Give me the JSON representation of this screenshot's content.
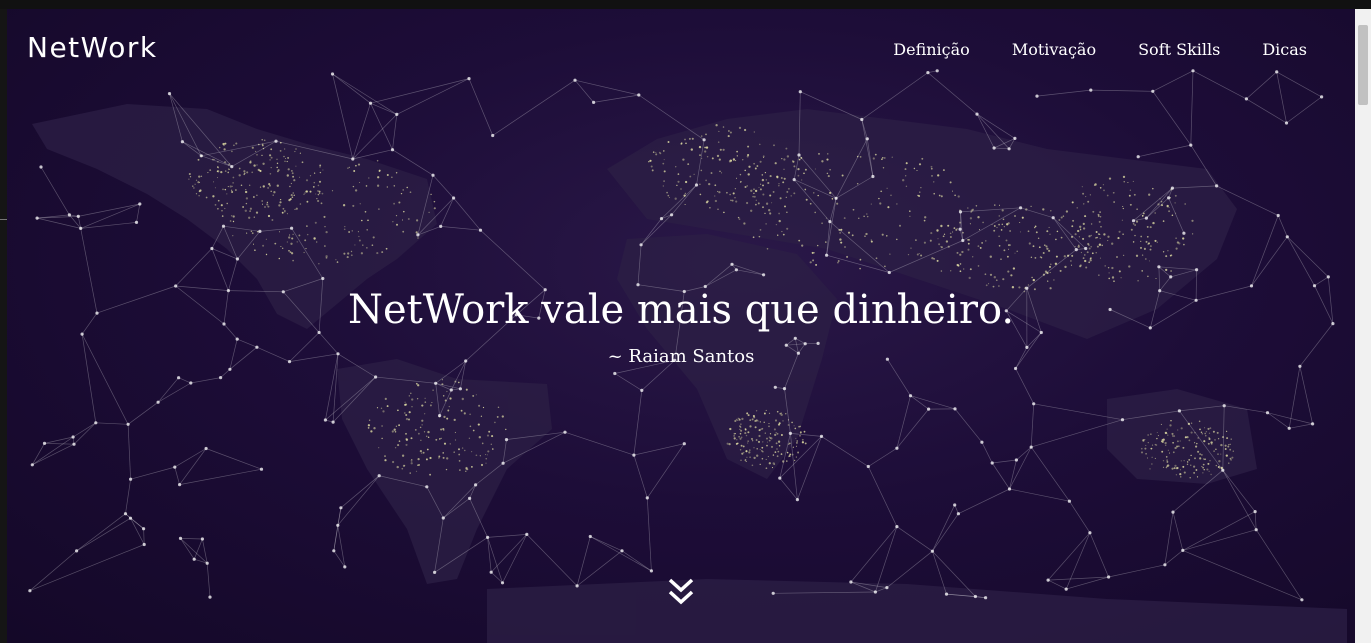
{
  "brand": {
    "name": "NetWork"
  },
  "nav": {
    "items": [
      {
        "label": "Definição"
      },
      {
        "label": "Motivação"
      },
      {
        "label": "Soft Skills"
      },
      {
        "label": "Dicas"
      }
    ]
  },
  "hero": {
    "quote": "NetWork vale mais que dinheiro.",
    "author": "~ Raiam Santos",
    "scroll_icon": "double-chevron-down-icon",
    "background": "world-network-map",
    "colors": {
      "base": "#1d0d38",
      "lines": "#ffffff",
      "city_lights": "#e8e6a8"
    }
  }
}
